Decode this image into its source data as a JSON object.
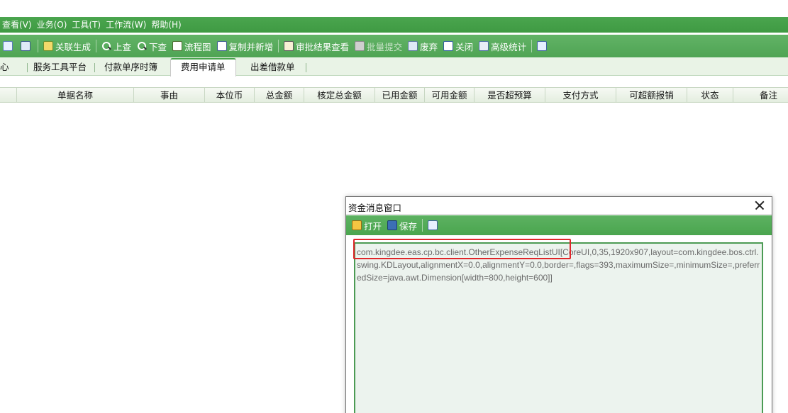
{
  "menubar": {
    "items": [
      "查看(V)",
      "业务(O)",
      "工具(T)",
      "工作流(W)",
      "帮助(H)"
    ]
  },
  "toolbar": {
    "items": [
      {
        "label": "",
        "icon": "print-icon"
      },
      {
        "label": "",
        "icon": "monitor-icon"
      },
      {
        "label": "关联生成",
        "icon": "link-generate-icon"
      },
      {
        "label": "上查",
        "icon": "search-up-icon"
      },
      {
        "label": "下查",
        "icon": "search-down-icon"
      },
      {
        "label": "流程图",
        "icon": "flowchart-icon"
      },
      {
        "label": "复制并新增",
        "icon": "copy-add-icon"
      },
      {
        "label": "审批结果查看",
        "icon": "approval-result-icon"
      },
      {
        "label": "批量提交",
        "icon": "batch-submit-icon",
        "disabled": true
      },
      {
        "label": "废弃",
        "icon": "discard-icon"
      },
      {
        "label": "关闭",
        "icon": "close-doc-icon"
      },
      {
        "label": "高级统计",
        "icon": "statistics-icon"
      },
      {
        "label": "",
        "icon": "exit-icon"
      }
    ]
  },
  "tabs": {
    "items": [
      "心",
      "服务工具平台",
      "付款单序时簿",
      "费用申请单",
      "出差借款单"
    ],
    "active": "费用申请单"
  },
  "grid": {
    "columns": [
      "单据名称",
      "事由",
      "本位币",
      "总金额",
      "核定总金额",
      "已用金额",
      "可用金额",
      "是否超预算",
      "支付方式",
      "可超额报销",
      "状态",
      "备注"
    ]
  },
  "dialog": {
    "title": "资金消息窗口",
    "open_label": "打开",
    "save_label": "保存",
    "content": "com.kingdee.eas.cp.bc.client.OtherExpenseReqListUI[CoreUI,0,35,1920x907,layout=com.kingdee.bos.ctrl.swing.KDLayout,alignmentX=0.0,alignmentY=0.0,border=,flags=393,maximumSize=,minimumSize=,preferredSize=java.awt.Dimension[width=800,height=600]]",
    "highlight_color": "#e0262a"
  },
  "colors": {
    "menubar": "#3f9a43",
    "toolbar": "#4fa454",
    "accent": "#4aa54e"
  }
}
